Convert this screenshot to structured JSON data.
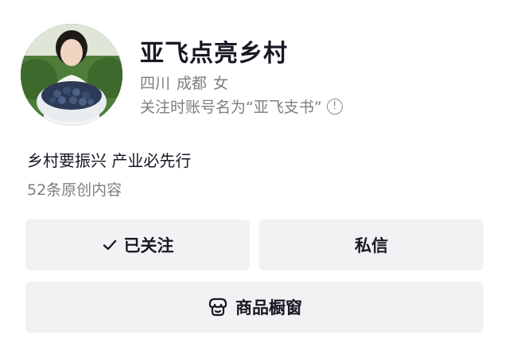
{
  "profile": {
    "nickname": "亚飞点亮乡村",
    "province": "四川",
    "city": "成都",
    "gender": "女",
    "former_name": "关注时账号名为“亚飞支书”",
    "info_icon_glyph": "!",
    "bio": "乡村要振兴 产业必先行",
    "works_count": "52条原创内容",
    "avatar_icon": "avatar-photo"
  },
  "actions": {
    "follow_label": "已关注",
    "follow_icon": "check-icon",
    "message_label": "私信",
    "shop_label": "商品橱窗",
    "shop_icon": "shop-window-icon"
  },
  "colors": {
    "primary_text": "#161823",
    "secondary_text": "#7d7e83",
    "button_bg": "#f2f2f4"
  }
}
